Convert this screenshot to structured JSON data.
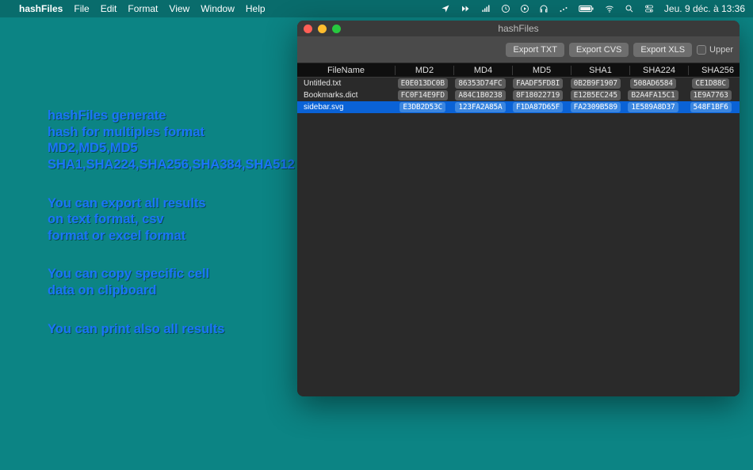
{
  "menubar": {
    "app": "hashFiles",
    "items": [
      "File",
      "Edit",
      "Format",
      "View",
      "Window",
      "Help"
    ],
    "clock": "Jeu. 9 déc. à  13:36"
  },
  "promo": {
    "block1": [
      "hashFiles generate",
      "hash for multiples format",
      "MD2,MD5,MD5",
      "SHA1,SHA224,SHA256,SHA384,SHA512"
    ],
    "block2": [
      "You can export all results",
      "on text format, csv",
      "format or excel format"
    ],
    "block3": [
      "You can copy specific cell",
      "data on clipboard"
    ],
    "block4": [
      "You can print also all results"
    ]
  },
  "window": {
    "title": "hashFiles",
    "toolbar": {
      "export_txt": "Export TXT",
      "export_cvs": "Export CVS",
      "export_xls": "Export XLS",
      "upper_label": "Upper"
    },
    "columns": [
      "FileName",
      "MD2",
      "MD4",
      "MD5",
      "SHA1",
      "SHA224",
      "SHA256"
    ],
    "rows": [
      {
        "file": "Untitled.txt",
        "selected": false,
        "hashes": [
          "E0E013DC0B",
          "86353D74FC",
          "FAADF5FD8I",
          "0B2B9F1907",
          "508AD6584",
          "CE1D88C"
        ]
      },
      {
        "file": "Bookmarks.dict",
        "selected": false,
        "hashes": [
          "FC0F14E9FD",
          "A84C1B0238",
          "8F18022719",
          "E12B5EC245",
          "B2A4FA15C1",
          "1E9A7763"
        ]
      },
      {
        "file": "sidebar.svg",
        "selected": true,
        "hashes": [
          "E3DB2D53C",
          "123FA2A85A",
          "F1DA87D65F",
          "FA2309B589",
          "1E589A8D37",
          "548F1BF6"
        ]
      }
    ]
  }
}
